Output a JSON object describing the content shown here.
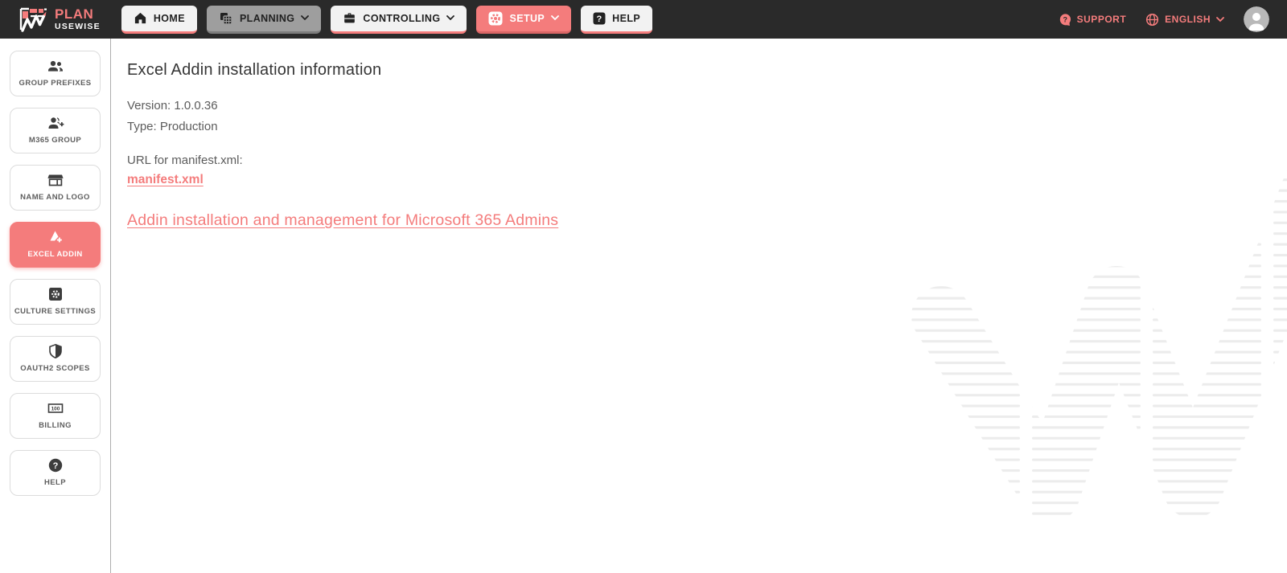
{
  "colors": {
    "accent": "#f47c7c",
    "navbar_bg": "#2a2a2a"
  },
  "navbar": {
    "logo": {
      "line1": "PLAN",
      "line2": "USEWISE"
    },
    "items": [
      {
        "label": "HOME",
        "icon": "home-icon",
        "active": true
      },
      {
        "label": "PLANNING",
        "icon": "planning-icon",
        "has_dropdown": true
      },
      {
        "label": "CONTROLLING",
        "icon": "briefcase-icon",
        "has_dropdown": true
      },
      {
        "label": "SETUP",
        "icon": "gear-icon",
        "has_dropdown": true
      },
      {
        "label": "HELP",
        "icon": "question-icon"
      }
    ],
    "support_label": "SUPPORT",
    "language_label": "ENGLISH"
  },
  "sidebar": {
    "items": [
      {
        "label": "GROUP PREFIXES",
        "icon": "group-icon"
      },
      {
        "label": "M365 GROUP",
        "icon": "person-add-icon"
      },
      {
        "label": "NAME AND LOGO",
        "icon": "storefront-icon"
      },
      {
        "label": "EXCEL ADDIN",
        "icon": "addin-icon",
        "active": true
      },
      {
        "label": "CULTURE SETTINGS",
        "icon": "settings-icon"
      },
      {
        "label": "OAUTH2 SCOPES",
        "icon": "shield-icon"
      },
      {
        "label": "BILLING",
        "icon": "billing-icon"
      },
      {
        "label": "HELP",
        "icon": "help-icon"
      }
    ]
  },
  "main": {
    "title": "Excel Addin installation information",
    "version": "Version: 1.0.0.36",
    "type": "Type: Production",
    "url_label": "URL for manifest.xml:",
    "manifest_link_label": "manifest.xml",
    "admin_link_label": "Addin installation and management for Microsoft 365 Admins"
  }
}
